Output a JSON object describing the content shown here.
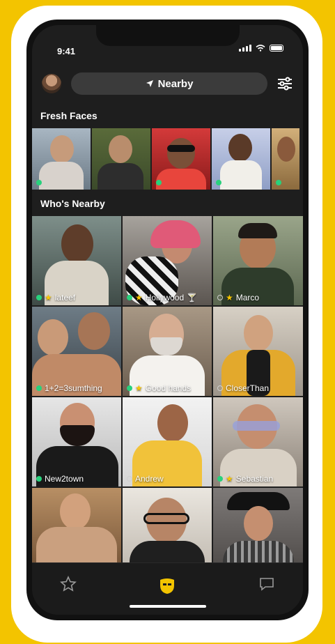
{
  "status": {
    "time": "9:41"
  },
  "header": {
    "location_label": "Nearby"
  },
  "sections": {
    "fresh_faces_title": "Fresh Faces",
    "whos_nearby_title": "Who's Nearby"
  },
  "fresh_faces": [
    {
      "online": true
    },
    {
      "online": false
    },
    {
      "online": true
    },
    {
      "online": true
    },
    {
      "online": true
    }
  ],
  "nearby": [
    {
      "name": "lateef",
      "online": true,
      "favorite": true,
      "extra": ""
    },
    {
      "name": "Hollywood",
      "online": true,
      "favorite": true,
      "extra": "🍸"
    },
    {
      "name": "Marco",
      "online": false,
      "favorite": true,
      "extra": ""
    },
    {
      "name": "1+2=3sumthing",
      "online": true,
      "favorite": false,
      "extra": ""
    },
    {
      "name": "Good hands",
      "online": true,
      "favorite": true,
      "extra": ""
    },
    {
      "name": "CloserThan",
      "online": false,
      "favorite": false,
      "extra": ""
    },
    {
      "name": "New2town",
      "online": true,
      "favorite": false,
      "extra": ""
    },
    {
      "name": "Andrew",
      "online": false,
      "favorite": false,
      "extra": ""
    },
    {
      "name": "Sebastian",
      "online": true,
      "favorite": true,
      "extra": ""
    },
    {
      "name": "",
      "online": false,
      "favorite": false,
      "extra": ""
    },
    {
      "name": "",
      "online": false,
      "favorite": false,
      "extra": ""
    },
    {
      "name": "",
      "online": false,
      "favorite": false,
      "extra": ""
    }
  ],
  "colors": {
    "brand_yellow": "#f3c400",
    "online_green": "#28d17c",
    "favorite_star": "#f7c600",
    "background": "#1e1e1e"
  }
}
